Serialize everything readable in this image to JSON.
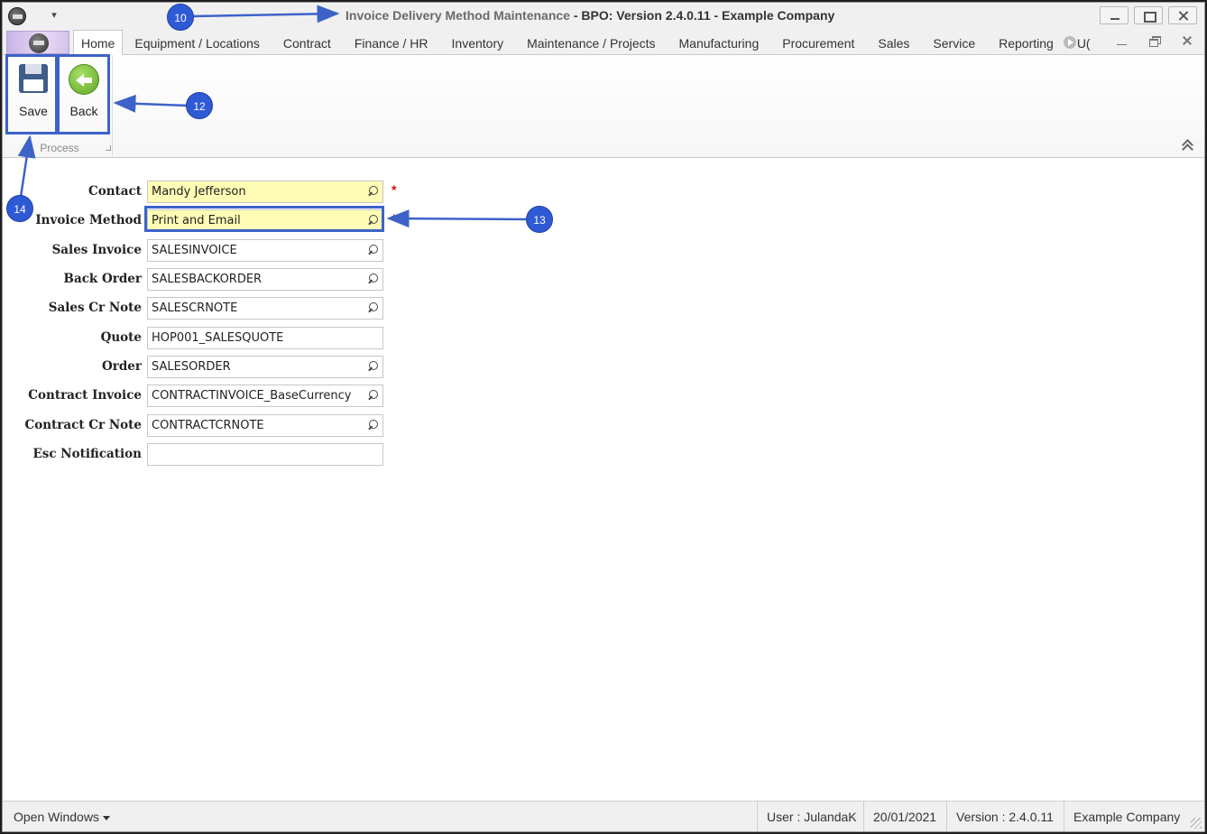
{
  "window": {
    "title_main": "Invoice Delivery Method Maintenance",
    "title_rest": "BPO: Version 2.4.0.11 - Example Company",
    "title_sep": " - "
  },
  "ribbon": {
    "tabs": [
      "Home",
      "Equipment / Locations",
      "Contract",
      "Finance / HR",
      "Inventory",
      "Maintenance / Projects",
      "Manufacturing",
      "Procurement",
      "Sales",
      "Service",
      "Reporting",
      "U("
    ],
    "active_tab": "Home",
    "group_label": "Process",
    "save_label": "Save",
    "back_label": "Back"
  },
  "form": {
    "fields": [
      {
        "label": "Contact",
        "value": "Mandy Jefferson",
        "required": true,
        "lookup": true
      },
      {
        "label": "Invoice Method",
        "value": "Print and Email",
        "required": true,
        "lookup": true
      },
      {
        "label": "Sales Invoice",
        "value": "SALESINVOICE",
        "required": false,
        "lookup": true
      },
      {
        "label": "Back Order",
        "value": "SALESBACKORDER",
        "required": false,
        "lookup": true
      },
      {
        "label": "Sales Cr Note",
        "value": "SALESCRNOTE",
        "required": false,
        "lookup": true
      },
      {
        "label": "Quote",
        "value": "HOP001_SALESQUOTE",
        "required": false,
        "lookup": false
      },
      {
        "label": "Order",
        "value": "SALESORDER",
        "required": false,
        "lookup": true
      },
      {
        "label": "Contract Invoice",
        "value": "CONTRACTINVOICE_BaseCurrency",
        "required": false,
        "lookup": true
      },
      {
        "label": "Contract Cr Note",
        "value": "CONTRACTCRNOTE",
        "required": false,
        "lookup": true
      },
      {
        "label": "Esc Notification",
        "value": "",
        "required": false,
        "lookup": false
      }
    ],
    "required_marker": "*"
  },
  "annotations": {
    "m10": "10",
    "m12": "12",
    "m13": "13",
    "m14": "14"
  },
  "statusbar": {
    "open_windows": "Open Windows",
    "user": "User : JulandaK",
    "date": "20/01/2021",
    "version": "Version : 2.4.0.11",
    "company": "Example Company"
  },
  "colors": {
    "annotation": "#2f5ad6",
    "required_bg": "#fffdb5",
    "required_star": "#d01010"
  }
}
